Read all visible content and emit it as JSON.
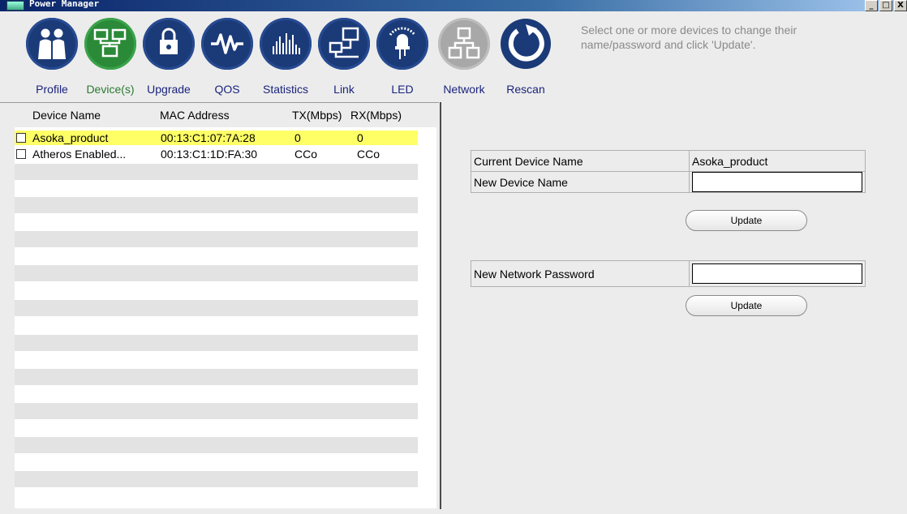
{
  "window": {
    "title": "Power Manager",
    "buttons": [
      "_",
      "□",
      "X"
    ]
  },
  "toolbar": {
    "items": [
      {
        "label": "Profile",
        "icon": "people-icon"
      },
      {
        "label": "Device(s)",
        "icon": "devices-icon",
        "active": true
      },
      {
        "label": "Upgrade",
        "icon": "upgrade-icon"
      },
      {
        "label": "QOS",
        "icon": "qos-icon"
      },
      {
        "label": "Statistics",
        "icon": "statistics-icon"
      },
      {
        "label": "Link",
        "icon": "link-icon"
      },
      {
        "label": "LED",
        "icon": "led-icon"
      },
      {
        "label": "Network",
        "icon": "network-icon",
        "disabled": true
      },
      {
        "label": "Rescan",
        "icon": "rescan-icon"
      }
    ],
    "hint": "Select one or more devices to change their name/password and click 'Update'."
  },
  "device_list": {
    "headers": {
      "name": "Device Name",
      "mac": "MAC Address",
      "tx": "TX(Mbps)",
      "rx": "RX(Mbps)"
    },
    "rows": [
      {
        "name": "Asoka_product",
        "mac": "00:13:C1:07:7A:28",
        "tx": "0",
        "rx": "0",
        "selected": true
      },
      {
        "name": "Atheros Enabled...",
        "mac": "00:13:C1:1D:FA:30",
        "tx": "CCo",
        "rx": "CCo",
        "selected": false
      }
    ]
  },
  "form": {
    "current_name_label": "Current Device Name",
    "current_name_value": "Asoka_product",
    "new_name_label": "New Device Name",
    "new_name_value": "",
    "update_label": "Update",
    "new_password_label": "New Network Password",
    "new_password_value": "",
    "update2_label": "Update"
  },
  "colors": {
    "accent": "#1b3a78",
    "active": "#2a8a38",
    "selected_row": "#ffff66"
  }
}
